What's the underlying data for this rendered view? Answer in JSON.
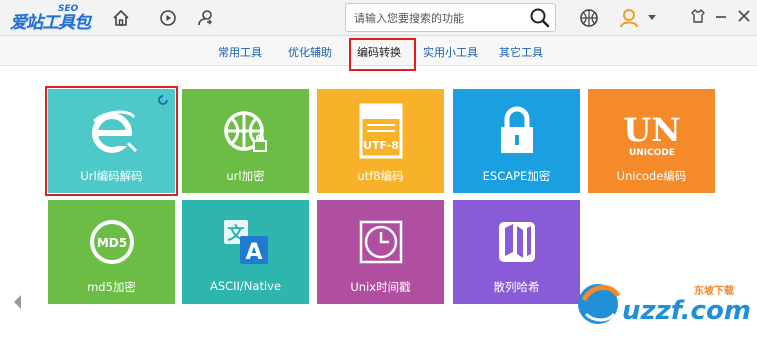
{
  "app": {
    "logo_text": "爱站工具包",
    "logo_sub": "SEO"
  },
  "toolbar": {
    "home_icon": "home-icon",
    "play_icon": "play-icon",
    "share_icon": "share-icon"
  },
  "search": {
    "placeholder": "请输入您要搜索的功能"
  },
  "tabs": [
    {
      "label": "常用工具",
      "active": false
    },
    {
      "label": "优化辅助",
      "active": false
    },
    {
      "label": "编码转换",
      "active": true
    },
    {
      "label": "实用小工具",
      "active": false
    },
    {
      "label": "其它工具",
      "active": false
    }
  ],
  "tools": [
    {
      "label": "Url编码解码",
      "color": "#4ec9c9",
      "icon": "ie-icon"
    },
    {
      "label": "url加密",
      "color": "#6cbd45",
      "icon": "basketball-lock-icon"
    },
    {
      "label": "utf8编码",
      "color": "#f7b22a",
      "icon": "utf8-icon"
    },
    {
      "label": "ESCAPE加密",
      "color": "#1a9fe0",
      "icon": "lock-icon"
    },
    {
      "label": "Unicode编码",
      "color": "#f58a2b",
      "icon": "unicode-icon"
    },
    {
      "label": "md5加密",
      "color": "#6cbd45",
      "icon": "md5-icon"
    },
    {
      "label": "ASCII/Native",
      "color": "#2db5ae",
      "icon": "translate-icon"
    },
    {
      "label": "Unix时间戳",
      "color": "#b04fa0",
      "icon": "clock-icon"
    },
    {
      "label": "散列哈希",
      "color": "#8a5bd6",
      "icon": "map-icon"
    }
  ],
  "watermark": {
    "text": "uzzf.com",
    "sub": "东坡下载"
  },
  "colors": {
    "brand": "#1f6fd0",
    "tab_link": "#1a5fb4",
    "highlight": "#e02020"
  }
}
